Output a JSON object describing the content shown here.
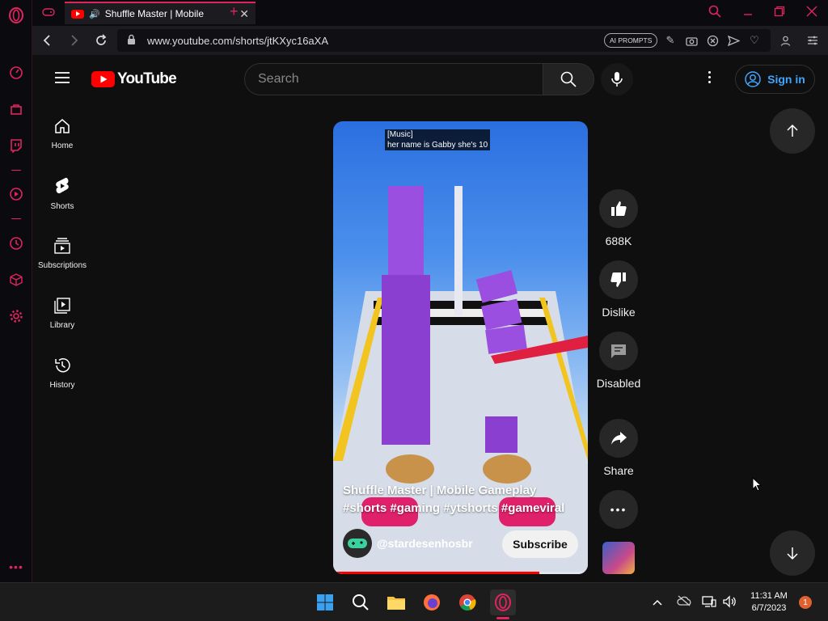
{
  "colors": {
    "opera_accent": "#e0245e",
    "youtube_red": "#ff0000",
    "link_blue": "#3ea6ff",
    "background": "#0f0f0f"
  },
  "browser": {
    "tab_title": "Shuffle Master | Mobile",
    "url": "www.youtube.com/shorts/jtKXyc16aXA",
    "ai_prompts_label": "AI PROMPTS"
  },
  "youtube": {
    "logo_text": "YouTube",
    "search_placeholder": "Search",
    "signin_label": "Sign in",
    "nav": [
      {
        "label": "Home",
        "icon": "home-icon"
      },
      {
        "label": "Shorts",
        "icon": "shorts-icon"
      },
      {
        "label": "Subscriptions",
        "icon": "subscriptions-icon"
      },
      {
        "label": "Library",
        "icon": "library-icon"
      },
      {
        "label": "History",
        "icon": "history-icon"
      }
    ]
  },
  "short": {
    "caption_line1": "[Music]",
    "caption_line2": "her name is Gabby she's 10",
    "title": "Shuffle Master | Mobile Gameplay #shorts #gaming #ytshorts #gameviral",
    "channel": "@stardesenhosbr",
    "subscribe_label": "Subscribe",
    "progress_fraction": 0.81
  },
  "actions": {
    "likes": "688K",
    "dislike_label": "Dislike",
    "comments_label": "Disabled",
    "share_label": "Share"
  },
  "taskbar": {
    "time": "11:31 AM",
    "date": "6/7/2023",
    "notification_count": "1"
  }
}
